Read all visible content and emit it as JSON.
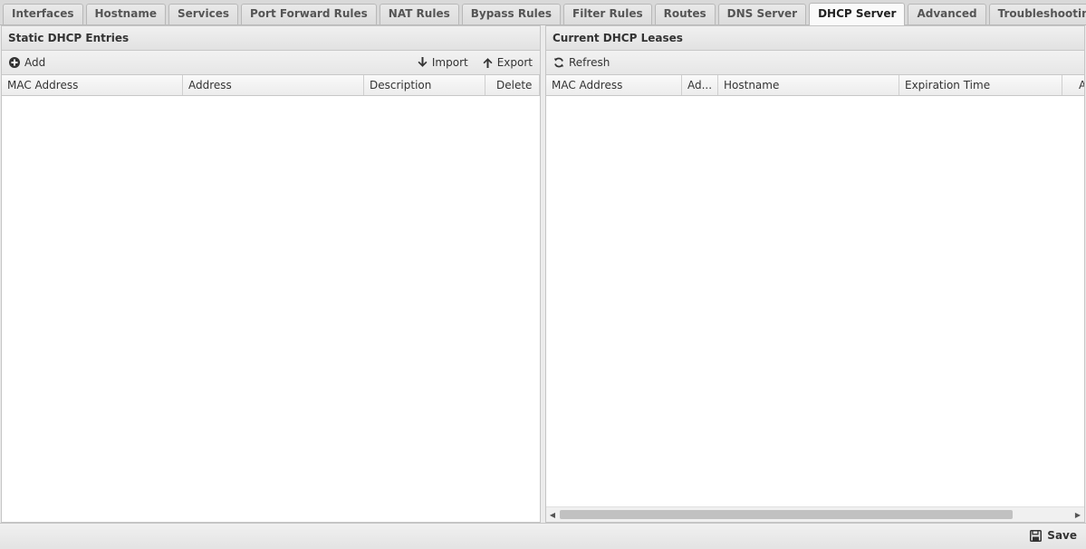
{
  "tabs": [
    {
      "label": "Interfaces",
      "active": false
    },
    {
      "label": "Hostname",
      "active": false
    },
    {
      "label": "Services",
      "active": false
    },
    {
      "label": "Port Forward Rules",
      "active": false
    },
    {
      "label": "NAT Rules",
      "active": false
    },
    {
      "label": "Bypass Rules",
      "active": false
    },
    {
      "label": "Filter Rules",
      "active": false
    },
    {
      "label": "Routes",
      "active": false
    },
    {
      "label": "DNS Server",
      "active": false
    },
    {
      "label": "DHCP Server",
      "active": true
    },
    {
      "label": "Advanced",
      "active": false
    },
    {
      "label": "Troubleshooting",
      "active": false
    }
  ],
  "static_panel": {
    "title": "Static DHCP Entries",
    "toolbar": {
      "add_label": "Add",
      "import_label": "Import",
      "export_label": "Export"
    },
    "columns": [
      "MAC Address",
      "Address",
      "Description",
      "Delete"
    ],
    "rows": []
  },
  "leases_panel": {
    "title": "Current DHCP Leases",
    "toolbar": {
      "refresh_label": "Refresh"
    },
    "columns": [
      "MAC Address",
      "Ad...",
      "Hostname",
      "Expiration Time",
      "A"
    ],
    "rows": []
  },
  "footer": {
    "save_label": "Save"
  }
}
